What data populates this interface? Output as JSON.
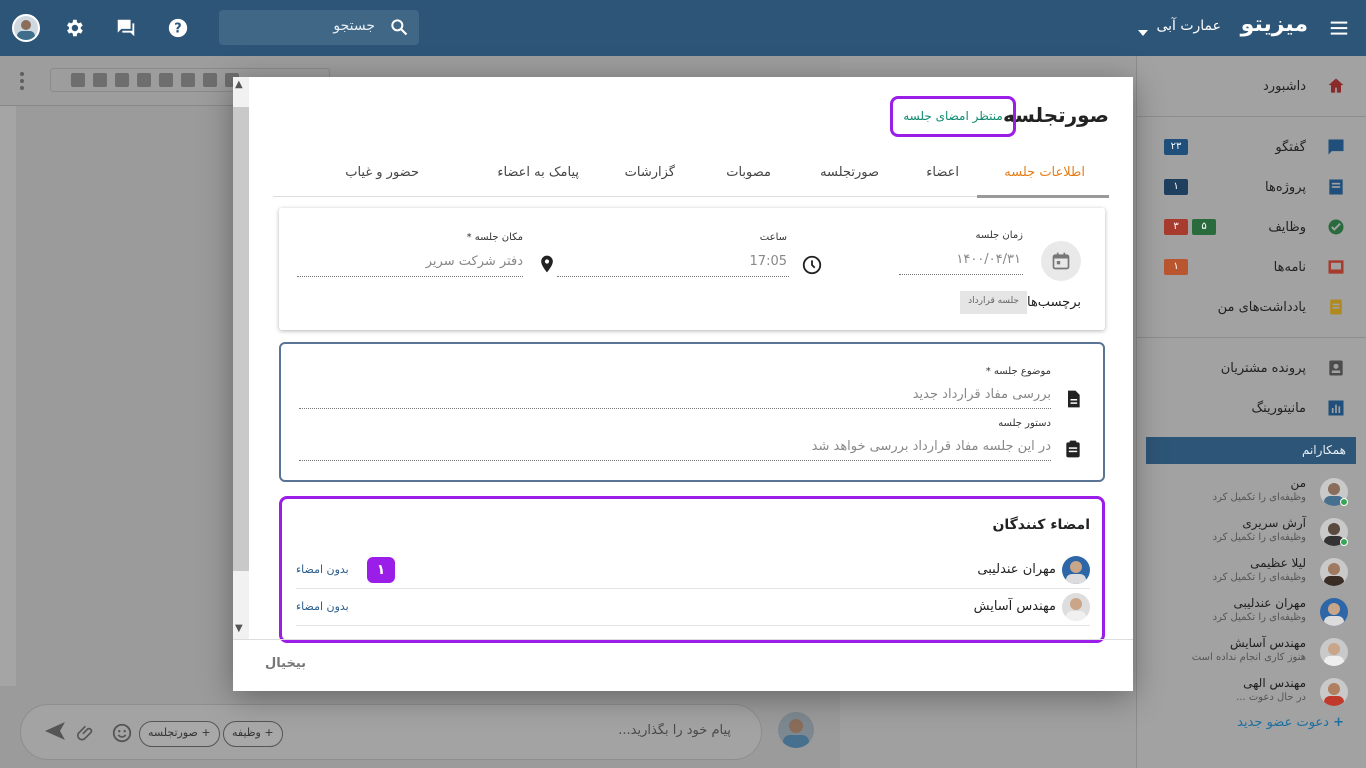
{
  "header": {
    "brand": "میزیتو",
    "org": "عمارت آبی",
    "search_placeholder": "جستجو"
  },
  "sidebar": {
    "items": [
      {
        "label": "داشبورد",
        "icon": "home-icon"
      },
      {
        "label": "گفتگو",
        "icon": "chat-icon",
        "badge": "۲۳"
      },
      {
        "label": "پروژه‌ها",
        "icon": "projects-icon",
        "badge": "۱"
      },
      {
        "label": "وظایف",
        "icon": "tasks-icon",
        "badge_green": "۵",
        "badge_red": "۳"
      },
      {
        "label": "نامه‌ها",
        "icon": "mail-icon",
        "badge": "۱"
      },
      {
        "label": "یادداشت‌های من",
        "icon": "notes-icon"
      },
      {
        "label": "پرونده مشتریان",
        "icon": "customers-icon"
      },
      {
        "label": "مانیتورینگ",
        "icon": "monitoring-icon"
      }
    ],
    "section": "همکارانم",
    "colleagues": [
      {
        "name": "من",
        "sub": "وظیفه‌ای را تکمیل کرد"
      },
      {
        "name": "آرش سریری",
        "sub": "وظیفه‌ای را تکمیل کرد"
      },
      {
        "name": "لیلا عظیمی",
        "sub": "وظیفه‌ای را تکمیل کرد"
      },
      {
        "name": "مهران عندلیبی",
        "sub": "وظیفه‌ای را تکمیل کرد"
      },
      {
        "name": "مهندس آسایش",
        "sub": "هنوز کاری انجام نداده است"
      },
      {
        "name": "مهندس الهی",
        "sub": "در حال دعوت ..."
      }
    ],
    "invite": "دعوت عضو جدید"
  },
  "composer": {
    "placeholder": "پیام خود را بگذارید...",
    "chip_minutes": "+ صورتجلسه",
    "chip_task": "+ وظیفه"
  },
  "modal": {
    "title": "صورتجلسه",
    "status": "منتظر امضای جلسه",
    "tabs": [
      "اطلاعات جلسه",
      "اعضاء",
      "صورتجلسه",
      "مصوبات",
      "گزارشات",
      "پیامک به اعضاء",
      "حضور و غیاب"
    ],
    "meeting": {
      "date_label": "زمان جلسه",
      "date_value": "۱۴۰۰/۰۴/۳۱",
      "time_label": "ساعت",
      "time_value": "17:05",
      "place_label": "مکان جلسه *",
      "place_value": "دفتر شرکت سریر",
      "tags_label": "برچسب‌ها:",
      "tag": "جلسه قرارداد"
    },
    "subject_label": "موضوع جلسه *",
    "subject_value": "بررسی مفاد قرارداد جدید",
    "agenda_label": "دستور جلسه",
    "agenda_value": "در این جلسه مفاد قرارداد بررسی خواهد شد",
    "signers_title": "امضاء کنندگان",
    "signers": [
      {
        "name": "مهران عندلیبی",
        "status": "بدون امضاء"
      },
      {
        "name": "مهندس آسایش",
        "status": "بدون امضاء"
      }
    ],
    "callout_number": "۱",
    "cancel": "بیخیال"
  },
  "colors": {
    "header_bg": "#2d5577",
    "accent_orange": "#e67e17",
    "highlight_purple": "#9b1de8",
    "status_green": "#0f8a6f"
  }
}
